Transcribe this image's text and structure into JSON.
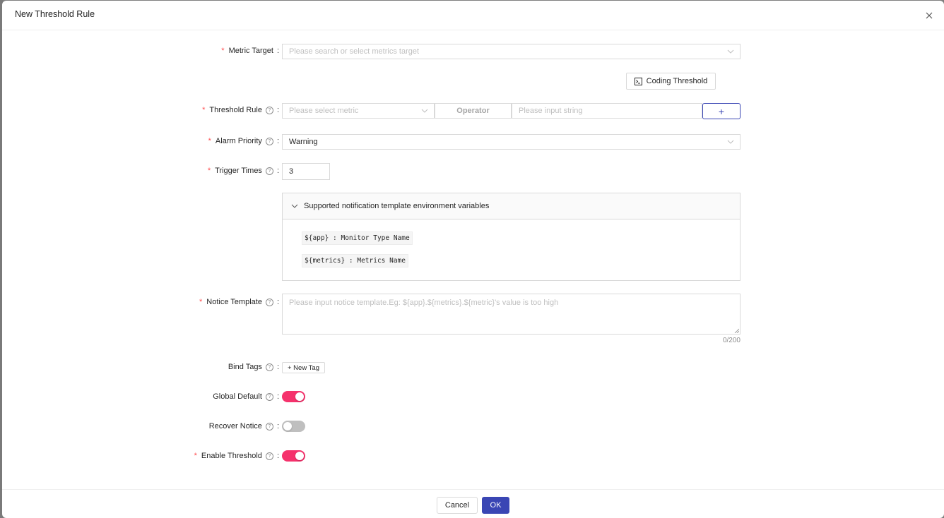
{
  "modal": {
    "title": "New Threshold Rule",
    "close_icon": "close-icon"
  },
  "form": {
    "metric_target": {
      "label": "Metric Target",
      "required": true,
      "placeholder": "Please search or select metrics target",
      "value": ""
    },
    "coding_threshold_button": {
      "label": "Coding Threshold",
      "icon": "terminal-icon"
    },
    "threshold_rule": {
      "label": "Threshold Rule",
      "required": true,
      "help": true,
      "metric_placeholder": "Please select metric",
      "operator_label": "Operator",
      "value_placeholder": "Please input string",
      "add_button_label": "+"
    },
    "alarm_priority": {
      "label": "Alarm Priority",
      "required": true,
      "help": true,
      "value": "Warning"
    },
    "trigger_times": {
      "label": "Trigger Times",
      "required": true,
      "help": true,
      "value": "3"
    },
    "env_variables": {
      "header": "Supported notification template environment variables",
      "expanded": true,
      "items": [
        "${app} : Monitor Type Name",
        "${metrics} : Metrics Name"
      ]
    },
    "notice_template": {
      "label": "Notice Template",
      "required": true,
      "help": true,
      "placeholder": "Please input notice template.Eg: ${app}.${metrics}.${metric}'s value is too high",
      "value": "",
      "counter": "0/200"
    },
    "bind_tags": {
      "label": "Bind Tags",
      "help": true,
      "new_tag_label": "+ New Tag"
    },
    "global_default": {
      "label": "Global Default",
      "help": true,
      "on": true
    },
    "recover_notice": {
      "label": "Recover Notice",
      "help": true,
      "on": false
    },
    "enable_threshold": {
      "label": "Enable Threshold",
      "required": true,
      "help": true,
      "on": true
    }
  },
  "footer": {
    "cancel_label": "Cancel",
    "ok_label": "OK"
  },
  "colors": {
    "primary": "#3a46b4",
    "switch_on": "#f5326c",
    "required": "#ff4d4f"
  }
}
